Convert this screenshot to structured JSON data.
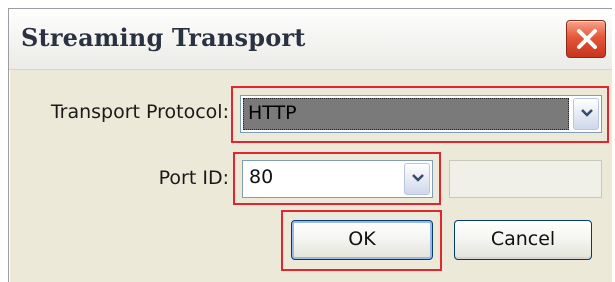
{
  "dialog": {
    "title": "Streaming Transport",
    "close_icon": "close-icon"
  },
  "transport_protocol": {
    "label": "Transport Protocol:",
    "value": "HTTP"
  },
  "port_id": {
    "label": "Port ID:",
    "value": "80",
    "extra_field_value": ""
  },
  "buttons": {
    "ok_label": "OK",
    "cancel_label": "Cancel"
  },
  "colors": {
    "highlight_box": "#e0262f",
    "close_button": "#d9482b",
    "dialog_background": "#ece9d8"
  }
}
